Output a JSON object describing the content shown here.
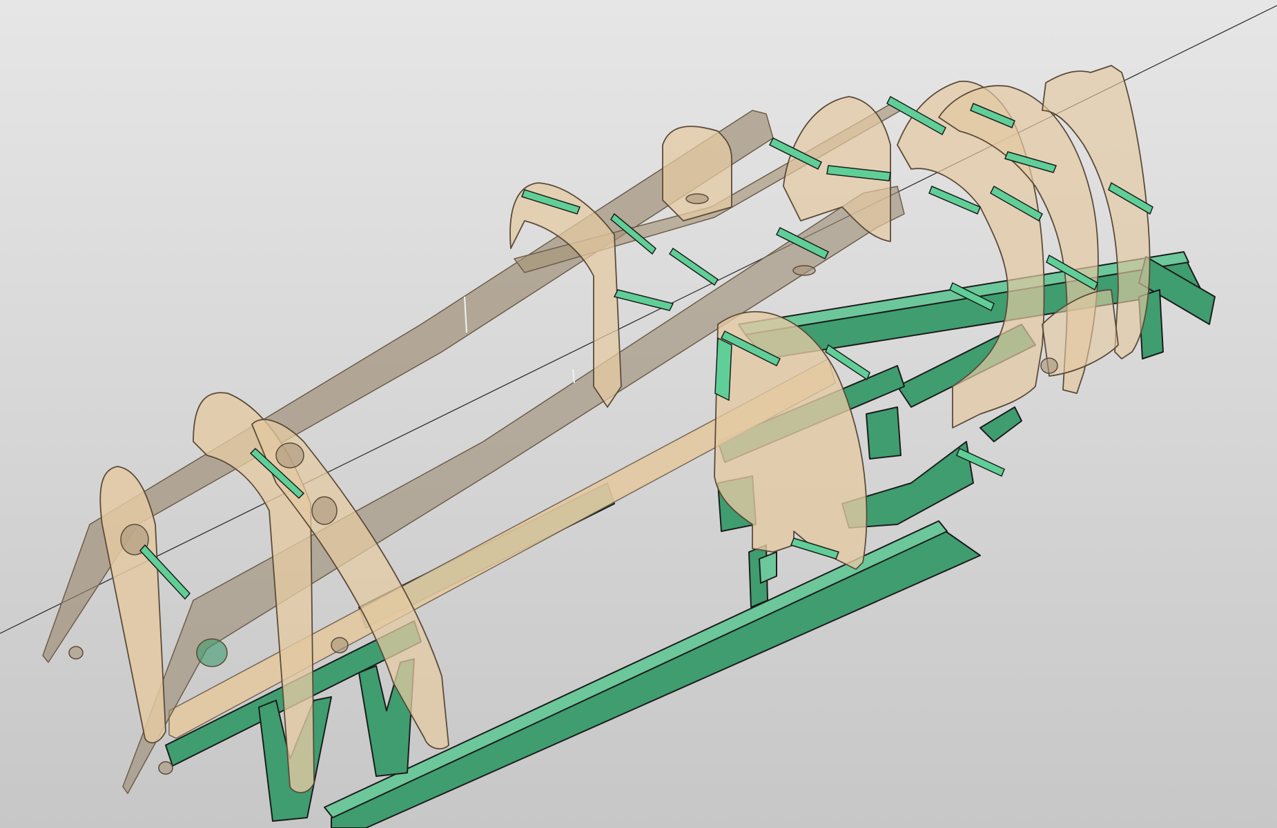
{
  "viewport": {
    "background_top": "#e6e6e6",
    "background_bottom": "#c7c7c7"
  },
  "colors": {
    "plywood": "#e4c9a2",
    "plywood_edge": "#6b5c48",
    "skin_panel": "#9d8c73",
    "jig_green": "#3f9d6f",
    "jig_green_light": "#6cc79a",
    "stringer_green": "#5fcf97",
    "outline": "#1e1e1e"
  },
  "model": {
    "parts": [
      "reference-axis",
      "building-jig-frame",
      "jig-cradles",
      "keel-panel",
      "side-panels",
      "fuselage-formers",
      "stringers"
    ]
  }
}
